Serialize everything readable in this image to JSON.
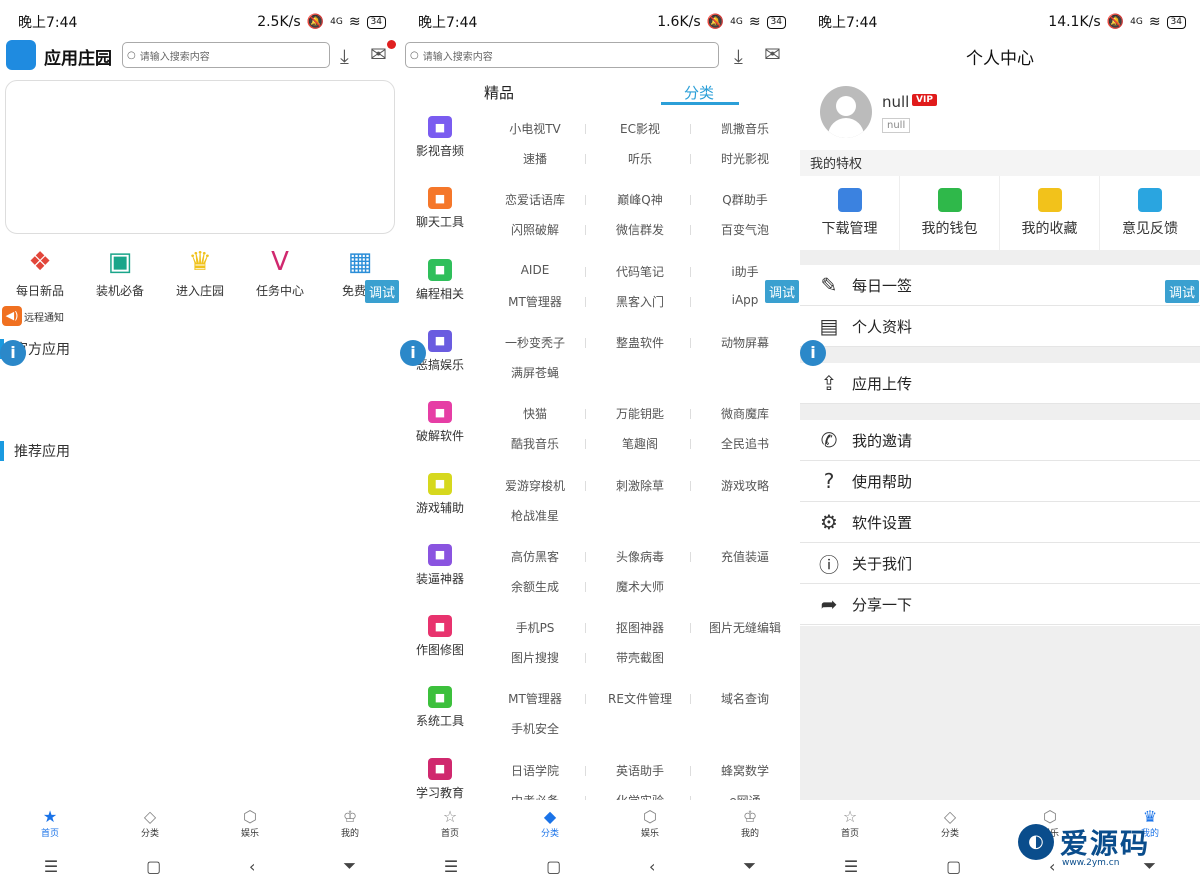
{
  "p1": {
    "status": {
      "time": "晚上7:44",
      "speed": "2.5K/s",
      "net": "4G",
      "battery": "34"
    },
    "logo_text": "应用庄园",
    "search_placeholder": "请输入搜索内容",
    "quick": [
      "每日新品",
      "装机必备",
      "进入庄园",
      "任务中心",
      "免费可"
    ],
    "notice": "远程通知",
    "section_official": "官方应用",
    "section_recommend": "推荐应用",
    "debug": "调试"
  },
  "p2": {
    "status": {
      "time": "晚上7:44",
      "speed": "1.6K/s",
      "net": "4G",
      "battery": "34"
    },
    "search_placeholder": "请输入搜索内容",
    "tab_featured": "精品",
    "tab_category": "分类",
    "debug": "调试",
    "categories": [
      {
        "name": "影视音频",
        "color": "#7a5cf0",
        "items": [
          "小电视TV",
          "EC影视",
          "凯撒音乐",
          "速播",
          "听乐",
          "时光影视"
        ]
      },
      {
        "name": "聊天工具",
        "color": "#f5772a",
        "items": [
          "恋爱话语库",
          "巅峰Q神",
          "Q群助手",
          "闪照破解",
          "微信群发",
          "百变气泡"
        ]
      },
      {
        "name": "编程相关",
        "color": "#2fbf5b",
        "items": [
          "AIDE",
          "代码笔记",
          "i助手",
          "MT管理器",
          "黑客入门",
          "iApp"
        ]
      },
      {
        "name": "恶搞娱乐",
        "color": "#6a5ce0",
        "items": [
          "一秒变秃子",
          "整蛊软件",
          "动物屏幕",
          "满屏苍蝇",
          "",
          ""
        ]
      },
      {
        "name": "破解软件",
        "color": "#e63ea5",
        "items": [
          "快猫",
          "万能钥匙",
          "微商魔库",
          "酷我音乐",
          "笔趣阁",
          "全民追书"
        ]
      },
      {
        "name": "游戏辅助",
        "color": "#d6d81e",
        "items": [
          "爱游穿梭机",
          "刺激除草",
          "游戏攻略",
          "枪战准星",
          "",
          ""
        ]
      },
      {
        "name": "装逼神器",
        "color": "#8a54e0",
        "items": [
          "高仿黑客",
          "头像病毒",
          "充值装逼",
          "余额生成",
          "魔术大师",
          ""
        ]
      },
      {
        "name": "作图修图",
        "color": "#e8336e",
        "items": [
          "手机PS",
          "抠图神器",
          "图片无缝编辑",
          "图片搜搜",
          "带壳截图",
          ""
        ]
      },
      {
        "name": "系统工具",
        "color": "#3cc03c",
        "items": [
          "MT管理器",
          "RE文件管理",
          "域名查询",
          "手机安全",
          "",
          ""
        ]
      },
      {
        "name": "学习教育",
        "color": "#d0286e",
        "items": [
          "日语学院",
          "英语助手",
          "蜂窝数学",
          "中考必备",
          "化学实验",
          "e网通"
        ]
      }
    ]
  },
  "p3": {
    "status": {
      "time": "晚上7:44",
      "speed": "14.1K/s",
      "net": "4G",
      "battery": "34"
    },
    "title": "个人中心",
    "username": "null",
    "vip": "VIP",
    "tag": "null",
    "priv_title": "我的特权",
    "privs": [
      {
        "label": "下载管理",
        "color": "#3b82e0"
      },
      {
        "label": "我的钱包",
        "color": "#2fb84a"
      },
      {
        "label": "我的收藏",
        "color": "#f2c21b"
      },
      {
        "label": "意见反馈",
        "color": "#2aa5e0"
      }
    ],
    "rows": [
      "每日一签",
      "个人资料",
      "应用上传",
      "我的邀请",
      "使用帮助",
      "软件设置",
      "关于我们",
      "分享一下"
    ],
    "debug": "调试"
  },
  "nav": [
    "首页",
    "分类",
    "娱乐",
    "我的"
  ],
  "watermark": {
    "text": "爱源码",
    "url": "www.2ym.cn"
  }
}
